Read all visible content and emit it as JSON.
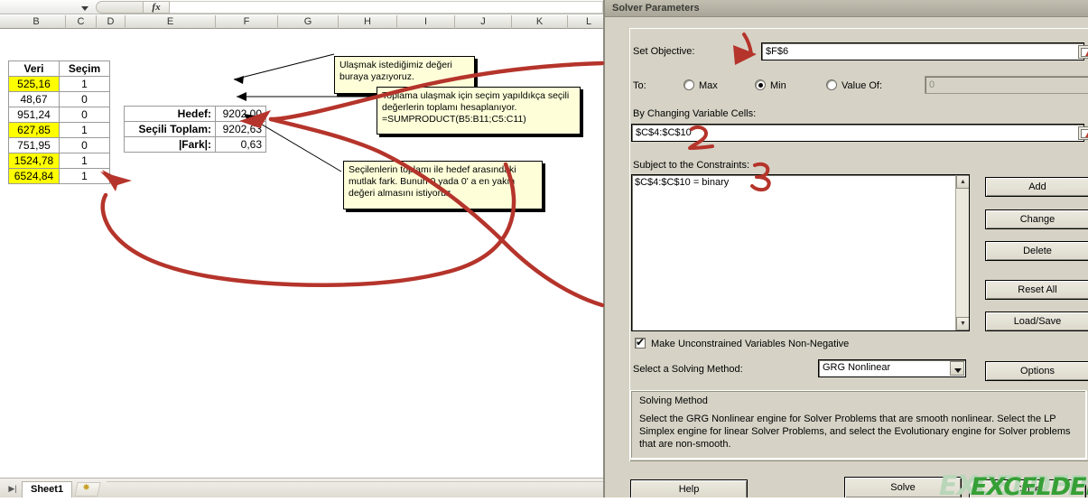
{
  "excel": {
    "formula_bar": {
      "fx_label": "fx"
    },
    "column_headers": [
      "B",
      "C",
      "D",
      "E",
      "F",
      "G",
      "H",
      "I",
      "J",
      "K",
      "L"
    ],
    "data_table": {
      "headers": [
        "Veri",
        "Seçim"
      ],
      "rows": [
        {
          "veri": "525,16",
          "secim": "1",
          "highlighted": true
        },
        {
          "veri": "48,67",
          "secim": "0",
          "highlighted": false
        },
        {
          "veri": "951,24",
          "secim": "0",
          "highlighted": false
        },
        {
          "veri": "627,85",
          "secim": "1",
          "highlighted": true
        },
        {
          "veri": "751,95",
          "secim": "0",
          "highlighted": false
        },
        {
          "veri": "1524,78",
          "secim": "1",
          "highlighted": true
        },
        {
          "veri": "6524,84",
          "secim": "1",
          "highlighted": true
        }
      ]
    },
    "summary_table": {
      "rows": [
        {
          "label": "Hedef:",
          "value": "9202,00"
        },
        {
          "label": "Seçili Toplam:",
          "value": "9202,63"
        },
        {
          "label": "|Fark|:",
          "value": "0,63"
        }
      ]
    },
    "callouts": [
      {
        "id": "target-note",
        "line1": "Ulaşmak istediğimiz değeri",
        "line2": "buraya yazıyoruz."
      },
      {
        "id": "sumproduct-note",
        "line1": "Toplama ulaşmak için seçim yapıldıkça seçili",
        "line2": "değerlerin toplamı hesaplanıyor.",
        "line3": "=SUMPRODUCT(B5:B11;C5:C11)"
      },
      {
        "id": "difference-note",
        "line1": "Seçilenlerin toplamı ile hedef arasındaki",
        "line2": "mutlak fark. Bunun 0 yada 0' a en yakın",
        "line3": "değeri almasını istiyoruz."
      }
    ],
    "sheet_tabs": {
      "active": "Sheet1",
      "new_sheet_icon": "new-sheet-icon",
      "nav_icon": "last-sheet-arrow-icon"
    }
  },
  "solver": {
    "title": "Solver Parameters",
    "set_objective": {
      "label": "Set Objective:",
      "value": "$F$6",
      "picker_icon": "range-picker-icon"
    },
    "to": {
      "label": "To:",
      "options": [
        {
          "label": "Max",
          "selected": false
        },
        {
          "label": "Min",
          "selected": true
        },
        {
          "label": "Value Of:",
          "selected": false
        }
      ],
      "value_of_field": "0"
    },
    "variable_cells": {
      "label": "By Changing Variable Cells:",
      "value": "$C$4:$C$10",
      "picker_icon": "range-picker-icon"
    },
    "constraints": {
      "label": "Subject to the Constraints:",
      "items": [
        "$C$4:$C$10 = binary"
      ],
      "scroll_up_icon": "scroll-up-icon",
      "scroll_down_icon": "scroll-down-icon"
    },
    "buttons": {
      "add": "Add",
      "change": "Change",
      "delete": "Delete",
      "reset_all": "Reset All",
      "load_save": "Load/Save",
      "options": "Options",
      "help": "Help",
      "solve": "Solve",
      "close": "Close"
    },
    "non_negative": {
      "label": "Make Unconstrained Variables Non-Negative",
      "checked": true
    },
    "solving_method": {
      "label": "Select a Solving Method:",
      "value": "GRG Nonlinear"
    },
    "method_group": {
      "title": "Solving Method",
      "description": "Select the GRG Nonlinear engine for Solver Problems that are smooth nonlinear. Select the LP Simplex engine for linear Solver Problems, and select the Evolutionary engine for Solver problems that are non-smooth."
    }
  },
  "annotations": {
    "color": "#c0392b",
    "marks": [
      {
        "id": "mark-1",
        "text": "1"
      },
      {
        "id": "mark-2",
        "text": "2"
      },
      {
        "id": "mark-3",
        "text": "3"
      }
    ]
  },
  "watermarks": [
    {
      "text": "EXCELDEPO",
      "color": "#3aa03a"
    },
    {
      "text": "EXCELDEPO",
      "color": "#9ec79e"
    }
  ]
}
